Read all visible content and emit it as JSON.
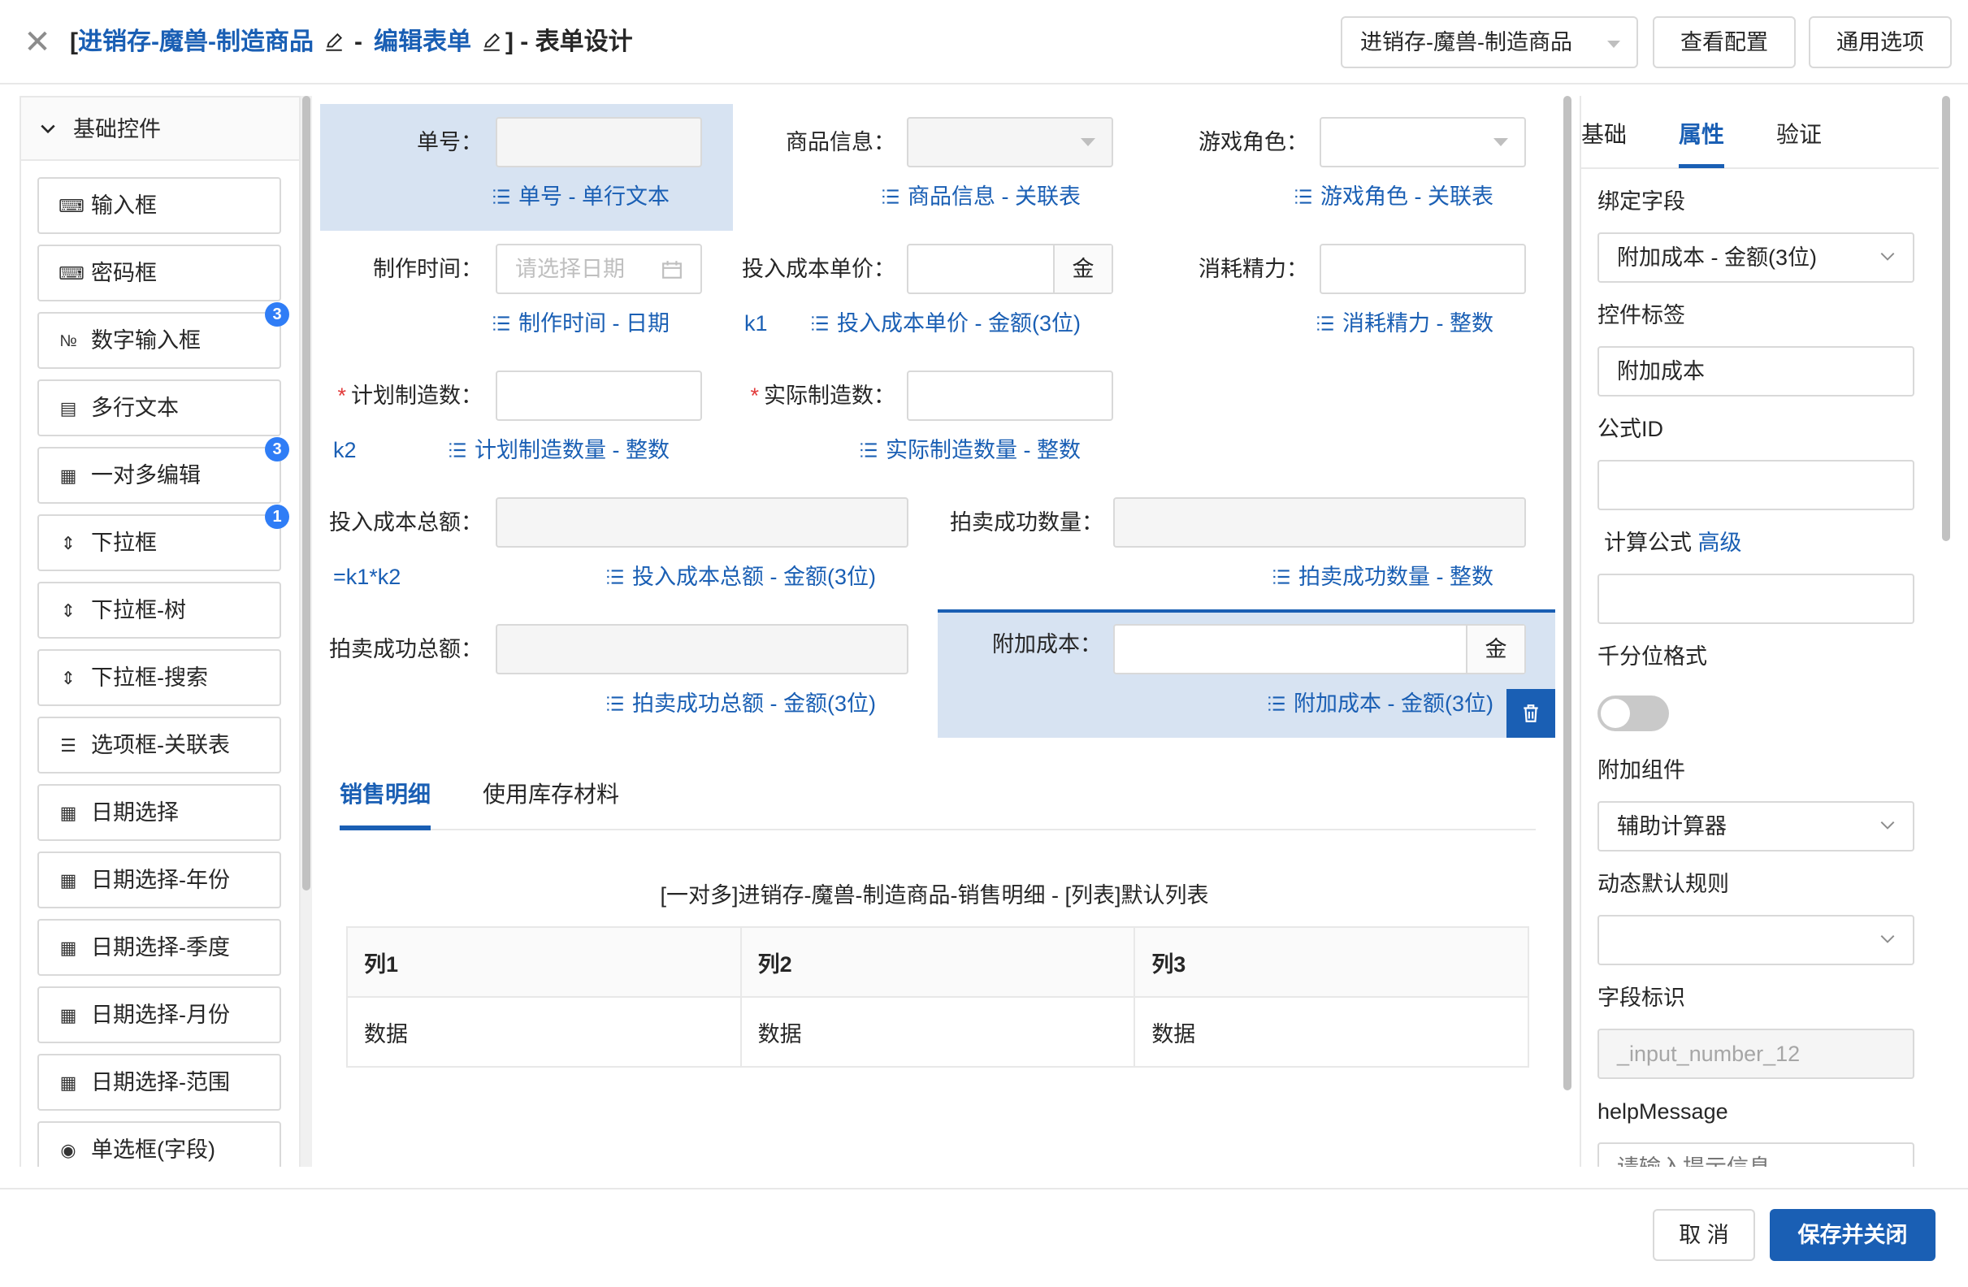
{
  "header": {
    "title": {
      "open": "[",
      "form_name": "进销存-魔兽-制造商品",
      "sep": " - ",
      "form_edit": "编辑表单",
      "close": "] - 表单设计"
    },
    "selector_value": "进销存-魔兽-制造商品",
    "view_config_label": "查看配置",
    "common_options_label": "通用选项"
  },
  "left_panel": {
    "title": "基础控件",
    "items": [
      {
        "label": "输入框",
        "icon": "input-icon"
      },
      {
        "label": "密码框",
        "icon": "input-icon"
      },
      {
        "label": "数字输入框",
        "icon": "number-icon",
        "badge": "3"
      },
      {
        "label": "多行文本",
        "icon": "document-icon"
      },
      {
        "label": "一对多编辑",
        "icon": "table-icon",
        "badge": "3"
      },
      {
        "label": "下拉框",
        "icon": "updown-icon",
        "badge": "1"
      },
      {
        "label": "下拉框-树",
        "icon": "updown-icon"
      },
      {
        "label": "下拉框-搜索",
        "icon": "updown-icon"
      },
      {
        "label": "选项框-关联表",
        "icon": "list-icon"
      },
      {
        "label": "日期选择",
        "icon": "calendar-icon"
      },
      {
        "label": "日期选择-年份",
        "icon": "calendar-icon"
      },
      {
        "label": "日期选择-季度",
        "icon": "calendar-icon"
      },
      {
        "label": "日期选择-月份",
        "icon": "calendar-icon"
      },
      {
        "label": "日期选择-范围",
        "icon": "calendar-icon"
      },
      {
        "label": "单选框(字段)",
        "icon": "radio-icon"
      }
    ]
  },
  "form": {
    "order_no": {
      "label": "单号：",
      "binding": "单号 - 单行文本"
    },
    "product_info": {
      "label": "商品信息：",
      "binding": "商品信息 - 关联表"
    },
    "game_role": {
      "label": "游戏角色：",
      "binding": "游戏角色 - 关联表"
    },
    "make_time": {
      "label": "制作时间：",
      "placeholder": "请选择日期",
      "binding": "制作时间 - 日期"
    },
    "unit_cost": {
      "label": "投入成本单价：",
      "addon": "金",
      "alias": "k1",
      "binding": "投入成本单价 - 金额(3位)"
    },
    "energy": {
      "label": "消耗精力：",
      "binding": "消耗精力 - 整数"
    },
    "plan_qty": {
      "required": "*",
      "label": "计划制造数：",
      "alias": "k2",
      "binding": "计划制造数量 - 整数"
    },
    "actual_qty": {
      "required": "*",
      "label": "实际制造数：",
      "binding": "实际制造数量 - 整数"
    },
    "total_cost": {
      "label": "投入成本总额：",
      "formula": "=k1*k2",
      "binding": "投入成本总额 - 金额(3位)"
    },
    "auction_qty": {
      "label": "拍卖成功数量：",
      "binding": "拍卖成功数量 - 整数"
    },
    "auction_total": {
      "label": "拍卖成功总额：",
      "binding": "拍卖成功总额 - 金额(3位)"
    },
    "extra_cost": {
      "label": "附加成本：",
      "addon": "金",
      "binding": "附加成本 - 金额(3位)"
    }
  },
  "subtabs": [
    "销售明细",
    "使用库存材料"
  ],
  "subform": {
    "title": "[一对多]进销存-魔兽-制造商品-销售明细 - [列表]默认列表",
    "columns": [
      "列1",
      "列2",
      "列3"
    ],
    "row": [
      "数据",
      "数据",
      "数据"
    ]
  },
  "right_panel": {
    "tabs": [
      "基础",
      "属性",
      "验证"
    ],
    "bind_field_label": "绑定字段",
    "bind_field_value": "附加成本 - 金额(3位)",
    "control_label_label": "控件标签",
    "control_label_value": "附加成本",
    "formula_id_label": "公式ID",
    "calc_formula_label": "计算公式",
    "advanced_link": "高级",
    "thousands_label": "千分位格式",
    "thousands_on": false,
    "addon_component_label": "附加组件",
    "addon_component_value": "辅助计算器",
    "dynamic_default_label": "动态默认规则",
    "field_id_label": "字段标识",
    "field_id_value": "_input_number_12",
    "help_message_label": "helpMessage",
    "help_message_placeholder": "请输入提示信息"
  },
  "footer": {
    "cancel_label": "取 消",
    "save_label": "保存并关闭"
  },
  "colors": {
    "accent": "#1a5fb4",
    "selected_bg": "#d7e3f2",
    "badge": "#2f7df6",
    "required": "#e23b3b"
  }
}
